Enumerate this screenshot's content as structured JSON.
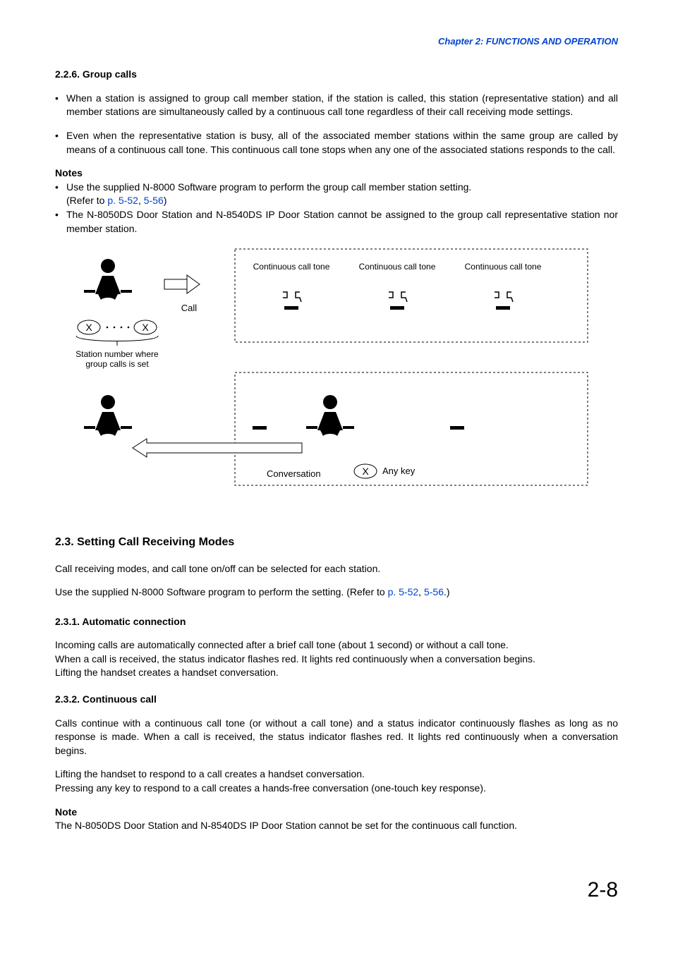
{
  "header": "Chapter 2:  FUNCTIONS AND OPERATION",
  "s226": {
    "title": "2.2.6. Group calls",
    "b1": "When a station is assigned to group call member station, if the station is called, this station (representative station) and all member stations are simultaneously called by a continuous call tone regardless of their call receiving mode settings.",
    "b2": "Even when the representative station is busy, all of the associated member stations within the same group are called by means of a continuous call tone. This continuous call tone stops when any one of the associated stations responds to the call.",
    "notes_head": "Notes",
    "note1": "Use the supplied N-8000 Software program to perform the group call member station setting.",
    "note1_refer_pre": "(Refer to ",
    "note1_link1": "p. 5-52",
    "note1_sep": ", ",
    "note1_link2": "5-56",
    "note1_refer_post": ")",
    "note2": "The N-8050DS Door Station and N-8540DS IP Door Station cannot be assigned to the group call representative station nor member station."
  },
  "diagram": {
    "call": "Call",
    "cct": "Continuous call tone",
    "stn_caption_l1": "Station number where",
    "stn_caption_l2": "group calls is set",
    "conversation": "Conversation",
    "any_key": "Any key",
    "x": "X"
  },
  "s23": {
    "title": "2.3. Setting Call Receiving Modes",
    "p1": "Call receiving modes, and call tone on/off can be selected for each station.",
    "p2_pre": "Use the supplied N-8000 Software program to perform the setting. (Refer to ",
    "p2_link1": "p. 5-52",
    "p2_sep": ", ",
    "p2_link2": "5-56",
    "p2_post": ".)"
  },
  "s231": {
    "title": "2.3.1. Automatic connection",
    "p1": "Incoming calls are automatically connected after a brief call tone (about 1 second) or without a call tone.",
    "p2": "When a call is received, the status indicator flashes red. It lights red continuously when a conversation begins.",
    "p3": "Lifting the handset creates a handset conversation."
  },
  "s232": {
    "title": "2.3.2. Continuous call",
    "p1": "Calls continue with a continuous call tone (or without a call tone) and a status indicator continuously flashes as long as no response is made. When a call is received, the status indicator flashes red. It lights red continuously when a conversation begins.",
    "p2": "Lifting the handset to respond to a call creates a handset conversation.",
    "p3": "Pressing any key to respond to a call creates a hands-free conversation (one-touch key response).",
    "note_head": "Note",
    "note": "The N-8050DS Door Station and N-8540DS IP Door Station cannot be set for the continuous call function."
  },
  "page_number": "2-8"
}
